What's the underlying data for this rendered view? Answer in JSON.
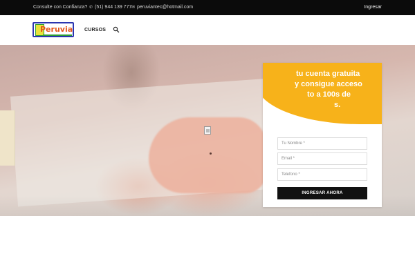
{
  "topbar": {
    "tagline": "Consulte con Confianza?",
    "phone": "(51) 944 139 777",
    "email": "peruviantec@hotmail.com",
    "login": "Ingresar",
    "phone_icon": "phone-icon",
    "email_icon": "envelope-icon"
  },
  "header": {
    "logo_text": "Peruvian",
    "nav": [
      {
        "label": "CURSOS"
      }
    ],
    "search_icon": "search-icon"
  },
  "signup": {
    "heading": "tu cuenta gratuita y consigue acceso to a 100s de s.",
    "heading_lines": [
      "tu cuenta gratuita",
      "y consigue acceso",
      "to a 100s de",
      "s."
    ],
    "name_placeholder": "Tu Nombre *",
    "email_placeholder": "Email *",
    "phone_placeholder": "Telefono *",
    "submit_label": "INGRESAR AHORA",
    "accent_color": "#f7b21a"
  }
}
